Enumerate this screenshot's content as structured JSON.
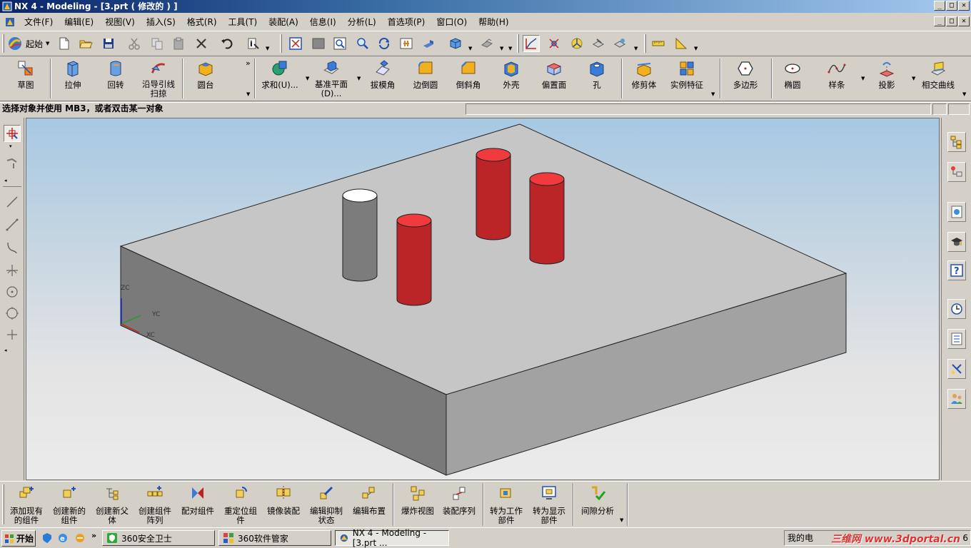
{
  "window": {
    "title": "NX 4 - Modeling - [3.prt ( 修改的 ) ]",
    "minimize": "_",
    "maximize": "□",
    "close": "✕"
  },
  "menubar": {
    "items": [
      "文件(F)",
      "编辑(E)",
      "视图(V)",
      "插入(S)",
      "格式(R)",
      "工具(T)",
      "装配(A)",
      "信息(I)",
      "分析(L)",
      "首选项(P)",
      "窗口(O)",
      "帮助(H)"
    ]
  },
  "standard_toolbar": {
    "start_label": "起始",
    "icons": [
      "new-icon",
      "open-icon",
      "save-icon",
      "cut-icon",
      "copy-icon",
      "paste-icon",
      "delete-icon",
      "undo-icon",
      "info-icon",
      "fit-icon",
      "zoom-box-icon",
      "zoom-icon",
      "pan-icon",
      "rotate-icon",
      "shaded-icon",
      "view-cube-icon",
      "render-icon",
      "snap-icon",
      "wcs-icon",
      "measure-icon"
    ]
  },
  "feature_toolbar": {
    "more": "»",
    "buttons": [
      {
        "label": "草图",
        "icon": "sketch-icon"
      },
      {
        "label": "拉伸",
        "icon": "extrude-icon"
      },
      {
        "label": "回转",
        "icon": "revolve-icon"
      },
      {
        "label": "沿导引线\n扫掠",
        "icon": "sweep-icon"
      },
      {
        "label": "圆台",
        "icon": "boss-icon"
      },
      {
        "label": "求和(U)...",
        "icon": "unite-icon"
      },
      {
        "label": "基准平面\n(D)...",
        "icon": "datum-plane-icon"
      },
      {
        "label": "拔模角",
        "icon": "draft-icon"
      },
      {
        "label": "边倒圆",
        "icon": "edge-blend-icon"
      },
      {
        "label": "倒斜角",
        "icon": "chamfer-icon"
      },
      {
        "label": "外壳",
        "icon": "shell-icon"
      },
      {
        "label": "偏置面",
        "icon": "offset-face-icon"
      },
      {
        "label": "孔",
        "icon": "hole-icon"
      },
      {
        "label": "修剪体",
        "icon": "trim-body-icon"
      },
      {
        "label": "实例特征",
        "icon": "instance-feature-icon"
      },
      {
        "label": "多边形",
        "icon": "polygon-icon"
      },
      {
        "label": "椭圆",
        "icon": "ellipse-icon"
      },
      {
        "label": "样条",
        "icon": "spline-icon"
      },
      {
        "label": "投影",
        "icon": "project-icon"
      },
      {
        "label": "相交曲线",
        "icon": "intersection-curve-icon"
      }
    ]
  },
  "cue_line": {
    "text": "选择对象并使用 MB3，或者双击某一对象"
  },
  "viewport": {
    "axis_labels": {
      "zc": "ZC",
      "yc": "YC",
      "xc": "XC"
    },
    "colors": {
      "block_top": "#c6c6c6",
      "block_left": "#7a7a7a",
      "block_right": "#a0a0a0",
      "cylinder_red": "#c0282a",
      "cylinder_top_red": "#f03a3e",
      "cylinder_gray": "#808080"
    }
  },
  "assembly_toolbar": {
    "buttons": [
      {
        "label": "添加现有\n的组件",
        "icon": "add-component-icon"
      },
      {
        "label": "创建新的\n组件",
        "icon": "new-component-icon"
      },
      {
        "label": "创建新父\n体",
        "icon": "new-parent-icon"
      },
      {
        "label": "创建组件\n阵列",
        "icon": "component-array-icon"
      },
      {
        "label": "配对组件",
        "icon": "mate-component-icon"
      },
      {
        "label": "重定位组\n件",
        "icon": "reposition-icon"
      },
      {
        "label": "镜像装配",
        "icon": "mirror-assembly-icon"
      },
      {
        "label": "编辑抑制\n状态",
        "icon": "edit-suppression-icon"
      },
      {
        "label": "编辑布置",
        "icon": "edit-arrangement-icon"
      },
      {
        "label": "爆炸视图",
        "icon": "exploded-view-icon"
      },
      {
        "label": "装配序列",
        "icon": "assembly-sequence-icon"
      },
      {
        "label": "转为工作\n部件",
        "icon": "make-work-part-icon"
      },
      {
        "label": "转为显示\n部件",
        "icon": "make-displayed-part-icon"
      },
      {
        "label": "间隙分析",
        "icon": "clearance-analysis-icon"
      }
    ]
  },
  "taskbar": {
    "start": "开始",
    "tasks": [
      "360安全卫士",
      "360软件管家",
      "NX 4 - Modeling - [3.prt ..."
    ],
    "tray_text": "我的电",
    "watermark": "三维网 www.3dportal.cn",
    "time": "6"
  }
}
